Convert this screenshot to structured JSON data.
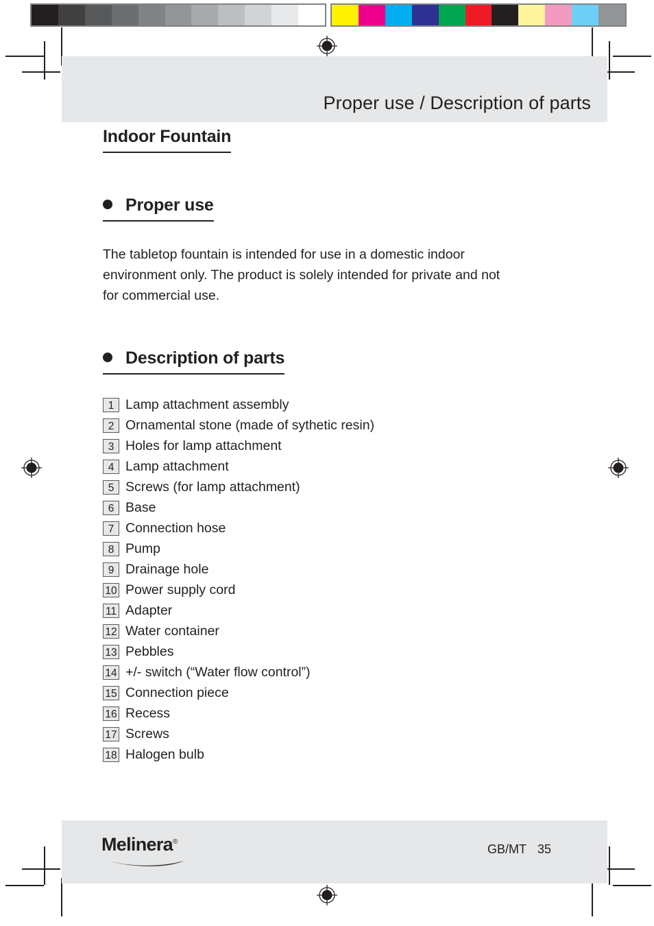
{
  "calibration": {
    "grayscale_label": "grayscale-step-wedge",
    "grayscale": [
      "#231f20",
      "#404041",
      "#58595b",
      "#6d6e71",
      "#808285",
      "#939598",
      "#a7a9ac",
      "#bcbec0",
      "#d1d3d4",
      "#e8e9ea",
      "#ffffff"
    ],
    "colors_label": "process-color-bar",
    "colors": [
      "#fff200",
      "#ec008c",
      "#00aeef",
      "#2e3192",
      "#00a651",
      "#ed1c24",
      "#231f20",
      "#fbf49a",
      "#f49ac1",
      "#6dcff6",
      "#939598"
    ]
  },
  "header": {
    "title": "Proper use / Description of parts"
  },
  "document": {
    "title": "Indoor Fountain"
  },
  "sections": [
    {
      "heading": "Proper use",
      "body": "The tabletop fountain is intended for use in a domestic indoor environment only. The product is solely intended for private and not for commercial use."
    },
    {
      "heading": "Description of parts"
    }
  ],
  "parts": [
    {
      "num": "1",
      "label": "Lamp attachment assembly"
    },
    {
      "num": "2",
      "label": "Ornamental stone (made of sythetic resin)"
    },
    {
      "num": "3",
      "label": "Holes for lamp attachment"
    },
    {
      "num": "4",
      "label": "Lamp attachment"
    },
    {
      "num": "5",
      "label": "Screws (for lamp attachment)"
    },
    {
      "num": "6",
      "label": "Base"
    },
    {
      "num": "7",
      "label": "Connection hose"
    },
    {
      "num": "8",
      "label": "Pump"
    },
    {
      "num": "9",
      "label": "Drainage hole"
    },
    {
      "num": "10",
      "label": "Power supply cord"
    },
    {
      "num": "11",
      "label": "Adapter"
    },
    {
      "num": "12",
      "label": "Water container"
    },
    {
      "num": "13",
      "label": "Pebbles"
    },
    {
      "num": "14",
      "label": "+/- switch (“Water flow control”)"
    },
    {
      "num": "15",
      "label": "Connection piece"
    },
    {
      "num": "16",
      "label": "Recess"
    },
    {
      "num": "17",
      "label": "Screws"
    },
    {
      "num": "18",
      "label": "Halogen bulb"
    }
  ],
  "footer": {
    "brand": "Melinera",
    "brand_mark": "®",
    "locale": "GB/MT",
    "page_number": "35"
  },
  "colors": {
    "band": "#e6e7e8",
    "ink": "#231f20",
    "num_box_border": "#58595b"
  }
}
